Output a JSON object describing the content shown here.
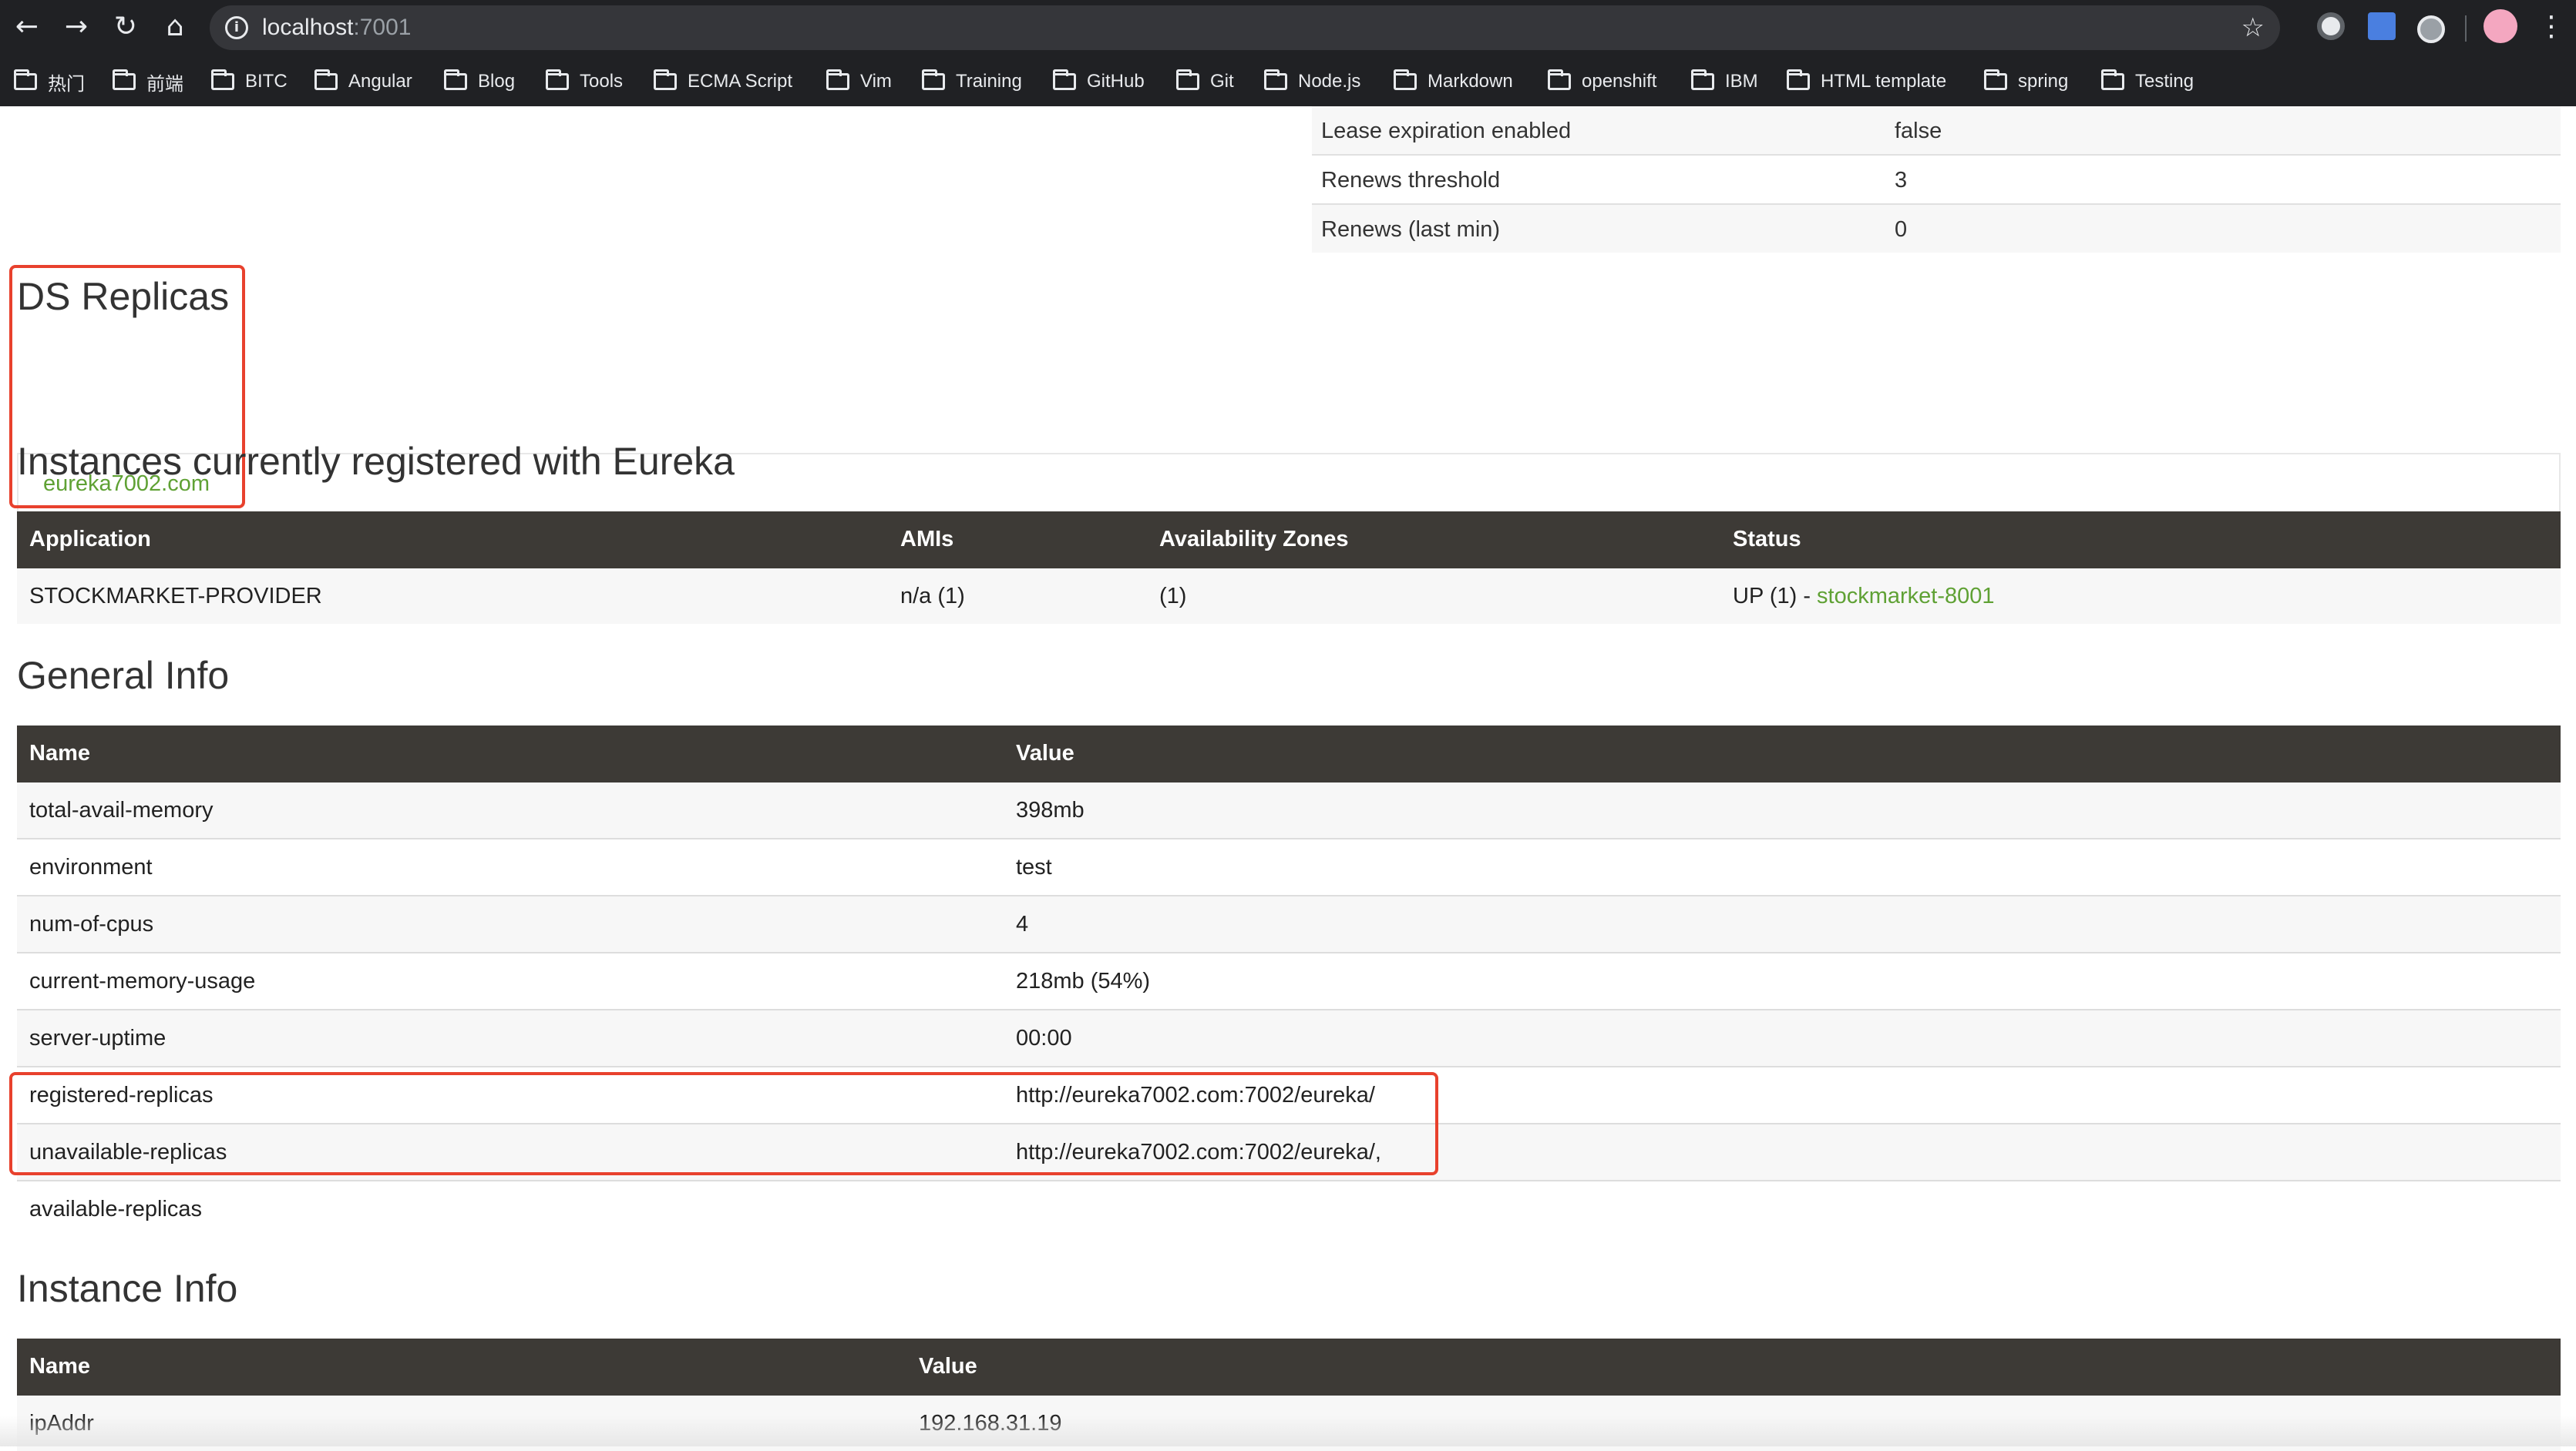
{
  "browser": {
    "url_host": "localhost",
    "url_port": ":7001",
    "bookmarks": [
      "热门",
      "前端",
      "BITC",
      "Angular",
      "Blog",
      "Tools",
      "ECMA Script",
      "Vim",
      "Training",
      "GitHub",
      "Git",
      "Node.js",
      "Markdown",
      "openshift",
      "IBM",
      "HTML template",
      "spring",
      "Testing"
    ]
  },
  "lease_table": {
    "rows": [
      {
        "name": "Lease expiration enabled",
        "value": "false"
      },
      {
        "name": "Renews threshold",
        "value": "3"
      },
      {
        "name": "Renews (last min)",
        "value": "0"
      }
    ]
  },
  "ds_replicas": {
    "title": "DS Replicas",
    "link": "eureka7002.com"
  },
  "instances": {
    "title": "Instances currently registered with Eureka",
    "headers": [
      "Application",
      "AMIs",
      "Availability Zones",
      "Status"
    ],
    "row": {
      "application": "STOCKMARKET-PROVIDER",
      "amis": "n/a (1)",
      "zones": "(1)",
      "status_prefix": "UP (1) - ",
      "status_link": "stockmarket-8001"
    }
  },
  "general_info": {
    "title": "General Info",
    "headers": [
      "Name",
      "Value"
    ],
    "rows": [
      {
        "name": "total-avail-memory",
        "value": "398mb"
      },
      {
        "name": "environment",
        "value": "test"
      },
      {
        "name": "num-of-cpus",
        "value": "4"
      },
      {
        "name": "current-memory-usage",
        "value": "218mb (54%)"
      },
      {
        "name": "server-uptime",
        "value": "00:00"
      },
      {
        "name": "registered-replicas",
        "value": "http://eureka7002.com:7002/eureka/"
      },
      {
        "name": "unavailable-replicas",
        "value": "http://eureka7002.com:7002/eureka/,"
      },
      {
        "name": "available-replicas",
        "value": ""
      }
    ]
  },
  "instance_info": {
    "title": "Instance Info",
    "headers": [
      "Name",
      "Value"
    ],
    "rows": [
      {
        "name": "ipAddr",
        "value": "192.168.31.19"
      }
    ]
  },
  "colors": {
    "chrome_bg": "#202124",
    "table_header": "#3d3a36",
    "link_green": "#5fa134",
    "highlight_red": "#e8412d"
  }
}
